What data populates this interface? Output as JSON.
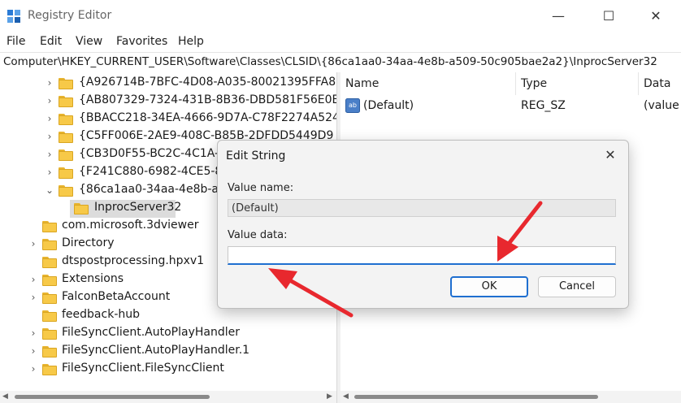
{
  "window": {
    "title": "Registry Editor",
    "minimize_glyph": "—",
    "maximize_glyph": "☐",
    "close_glyph": "✕"
  },
  "menu": [
    "File",
    "Edit",
    "View",
    "Favorites",
    "Help"
  ],
  "address_bar": "Computer\\HKEY_CURRENT_USER\\Software\\Classes\\CLSID\\{86ca1aa0-34aa-4e8b-a509-50c905bae2a2}\\InprocServer32",
  "tree": [
    {
      "label": "{A926714B-7BFC-4D08-A035-80021395FFA8",
      "chevron": "›"
    },
    {
      "label": "{AB807329-7324-431B-8B36-DBD581F56E0E",
      "chevron": "›"
    },
    {
      "label": "{BBACC218-34EA-4666-9D7A-C78F2274A524",
      "chevron": "›"
    },
    {
      "label": "{C5FF006E-2AE9-408C-B85B-2DFDD5449D9",
      "chevron": "›"
    },
    {
      "label": "{CB3D0F55-BC2C-4C1A-85",
      "chevron": "›"
    },
    {
      "label": "{F241C880-6982-4CE5-8C",
      "chevron": "›"
    },
    {
      "label": "{86ca1aa0-34aa-4e8b-a50",
      "chevron": "⌄"
    },
    {
      "label": "InprocServer32",
      "chevron": ""
    },
    {
      "label": "com.microsoft.3dviewer",
      "chevron": ""
    },
    {
      "label": "Directory",
      "chevron": "›"
    },
    {
      "label": "dtspostprocessing.hpxv1",
      "chevron": ""
    },
    {
      "label": "Extensions",
      "chevron": "›"
    },
    {
      "label": "FalconBetaAccount",
      "chevron": "›"
    },
    {
      "label": "feedback-hub",
      "chevron": ""
    },
    {
      "label": "FileSyncClient.AutoPlayHandler",
      "chevron": "›"
    },
    {
      "label": "FileSyncClient.AutoPlayHandler.1",
      "chevron": "›"
    },
    {
      "label": "FileSyncClient.FileSyncClient",
      "chevron": "›"
    }
  ],
  "values_pane": {
    "columns": [
      "Name",
      "Type",
      "Data"
    ],
    "rows": [
      {
        "icon": "ab",
        "name": "(Default)",
        "type": "REG_SZ",
        "data": "(value n"
      }
    ]
  },
  "dialog": {
    "title": "Edit String",
    "close_glyph": "✕",
    "value_name_label": "Value name:",
    "value_name": "(Default)",
    "value_data_label": "Value data:",
    "value_data": "",
    "ok_label": "OK",
    "cancel_label": "Cancel"
  },
  "colors": {
    "folder": "#f7c948",
    "accent": "#1f6fd0",
    "annotation_arrow": "#e8282e"
  }
}
